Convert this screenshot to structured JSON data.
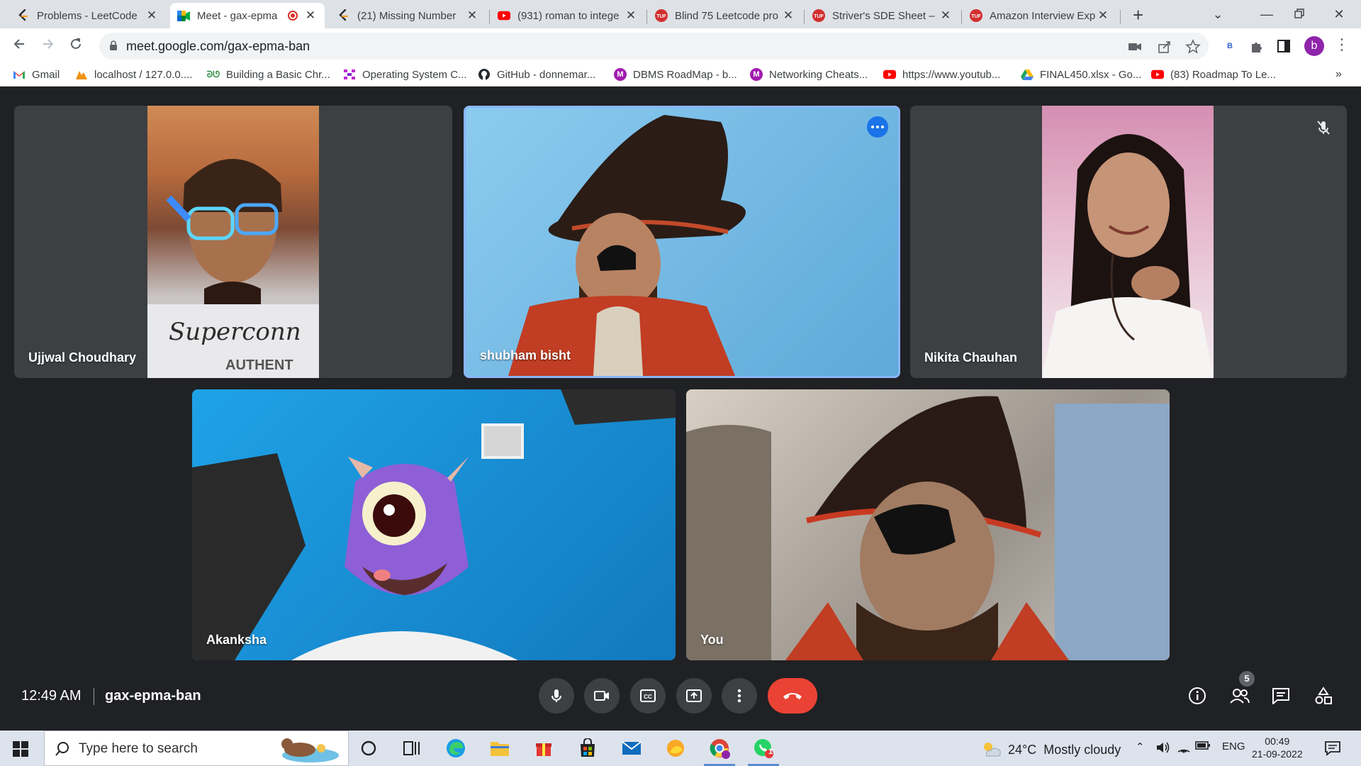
{
  "browser": {
    "tabs": [
      {
        "title": "Problems - LeetCode",
        "icon": "leetcode-icon"
      },
      {
        "title": "Meet - gax-epma",
        "icon": "google-meet-icon",
        "active": true,
        "recording": true
      },
      {
        "title": "(21) Missing Number",
        "icon": "leetcode-icon"
      },
      {
        "title": "(931) roman to intege",
        "icon": "youtube-icon"
      },
      {
        "title": "Blind 75 Leetcode pro",
        "icon": "tuf-icon"
      },
      {
        "title": "Striver's SDE Sheet –",
        "icon": "tuf-icon"
      },
      {
        "title": "Amazon Interview Exp",
        "icon": "tuf-icon"
      }
    ],
    "url": "meet.google.com/gax-epma-ban",
    "profile_initial": "b",
    "extension_label": "B",
    "bookmarks": [
      {
        "label": "Gmail",
        "icon": "gmail-icon",
        "color": "#ea4335"
      },
      {
        "label": "localhost / 127.0.0....",
        "icon": "phpmyadmin-icon",
        "color": "#f29111"
      },
      {
        "label": "Building a Basic Chr...",
        "icon": "gfg-icon",
        "color": "#2f8d46"
      },
      {
        "label": "Operating System C...",
        "icon": "grid-icon",
        "color": "#c026d3"
      },
      {
        "label": "GitHub - donnemar...",
        "icon": "github-icon",
        "color": "#24292e"
      },
      {
        "label": "DBMS RoadMap - b...",
        "icon": "medium-m-icon",
        "color": "#a21caf"
      },
      {
        "label": "Networking Cheats...",
        "icon": "medium-m-icon",
        "color": "#a21caf"
      },
      {
        "label": "https://www.youtub...",
        "icon": "youtube-icon",
        "color": "#ff0000"
      },
      {
        "label": "FINAL450.xlsx - Go...",
        "icon": "google-drive-icon",
        "color": "#1fa463"
      },
      {
        "label": "(83) Roadmap To Le...",
        "icon": "youtube-icon",
        "color": "#ff0000"
      }
    ]
  },
  "meet": {
    "participants": [
      {
        "name": "Ujjwal Choudhary",
        "muted": false,
        "speaking": false
      },
      {
        "name": "shubham bisht",
        "muted": false,
        "speaking": true
      },
      {
        "name": "Nikita Chauhan",
        "muted": true,
        "speaking": false
      },
      {
        "name": "Akanksha",
        "muted": false,
        "speaking": false
      },
      {
        "name": "You",
        "muted": false,
        "speaking": false
      }
    ],
    "time": "12:49 AM",
    "meeting_code": "gax-epma-ban",
    "people_count": "5",
    "end_call_color": "#ea4335"
  },
  "taskbar": {
    "search_placeholder": "Type here to search",
    "weather_temp": "24°C",
    "weather_text": "Mostly cloudy",
    "language": "ENG",
    "time": "00:49",
    "date": "21-09-2022",
    "notification_badge": "1"
  }
}
